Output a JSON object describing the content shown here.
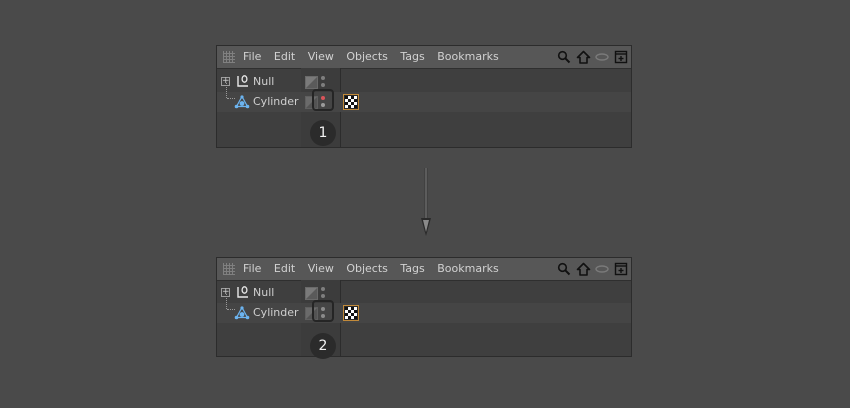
{
  "menubar": {
    "items": [
      "File",
      "Edit",
      "View",
      "Objects",
      "Tags",
      "Bookmarks"
    ],
    "tool_icons": [
      "search-icon",
      "home-icon",
      "view-toggle-icon",
      "new-window-icon"
    ]
  },
  "panels": [
    {
      "objects": [
        {
          "name": "Null",
          "icon": "null-object-icon"
        },
        {
          "name": "Cylinder",
          "icon": "cylinder-icon"
        }
      ],
      "step": "1",
      "cylinder_dots": {
        "top": "#d9545a",
        "bottom": "#9b9b9b"
      }
    },
    {
      "objects": [
        {
          "name": "Null",
          "icon": "null-object-icon"
        },
        {
          "name": "Cylinder",
          "icon": "cylinder-icon"
        }
      ],
      "step": "2",
      "cylinder_dots": {
        "top": "#8b8b8b",
        "bottom": "#8b8b8b"
      }
    }
  ],
  "colors": {
    "background": "#4a4a4a",
    "panel": "#3f3f3f",
    "menubar": "#575757",
    "cylinder_icon": "#6cb4f0",
    "material_tag_border": "#c28a3a",
    "red_dot": "#d9545a"
  }
}
